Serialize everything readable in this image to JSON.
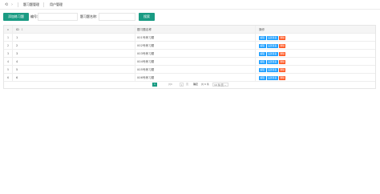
{
  "topnav": {
    "refresh_icon": "refresh-icon",
    "arrow_icon": "chevron-icon",
    "links": [
      "题习题管理",
      "用户管理"
    ]
  },
  "search": {
    "add_button": "添加练习题",
    "label1": "编号:",
    "label2": "题习题名称:",
    "search_button": "搜索"
  },
  "table": {
    "headers": {
      "num": "",
      "id": "ID",
      "name": "题习题名称",
      "op": "操作"
    },
    "sort_icon": "↕",
    "rows": [
      {
        "num": "1",
        "id": "1",
        "name": "001号练习题"
      },
      {
        "num": "2",
        "id": "2",
        "name": "002号练习题"
      },
      {
        "num": "3",
        "id": "3",
        "name": "003号练习题"
      },
      {
        "num": "4",
        "id": "4",
        "name": "004号练习题"
      },
      {
        "num": "5",
        "id": "5",
        "name": "005号练习题"
      },
      {
        "num": "6",
        "id": "6",
        "name": "006号练习题"
      }
    ],
    "op_labels": {
      "edit": "编辑",
      "set": "设置答案",
      "del": "删除"
    }
  },
  "pager": {
    "current": "1",
    "prev": "共6",
    "page_box": "1",
    "jump_label": "页",
    "ok": "确定",
    "total": "共 6 条",
    "size": "10 条/页 ⌄"
  },
  "colors": {
    "accent": "#1a9b83",
    "edit": "#1e9fff",
    "delete": "#ff5722"
  }
}
